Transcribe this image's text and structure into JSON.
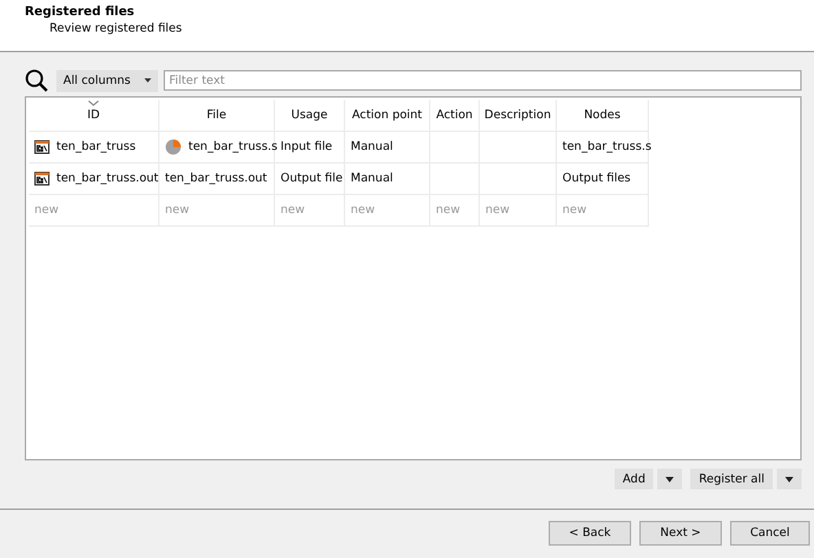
{
  "header": {
    "title": "Registered files",
    "subtitle": "Review registered files"
  },
  "filter": {
    "scope": "All columns",
    "placeholder": "Filter text"
  },
  "table": {
    "columns": [
      {
        "label": "ID",
        "sorted": true
      },
      {
        "label": "File",
        "sorted": false
      },
      {
        "label": "Usage",
        "sorted": false
      },
      {
        "label": "Action point",
        "sorted": false
      },
      {
        "label": "Action",
        "sorted": false
      },
      {
        "label": "Description",
        "sorted": false
      },
      {
        "label": "Nodes",
        "sorted": false
      }
    ],
    "rows": [
      {
        "kind": "file",
        "cells": [
          {
            "text": "ten_bar_truss",
            "kind": "console"
          },
          {
            "text": "ten_bar_truss.s",
            "kind": "disc"
          },
          {
            "text": "Input file"
          },
          {
            "text": "Manual"
          },
          {
            "kind": "empty"
          },
          {
            "kind": "empty"
          },
          {
            "text": "ten_bar_truss.s"
          }
        ]
      },
      {
        "kind": "file",
        "cells": [
          {
            "text": "ten_bar_truss.out",
            "kind": "console"
          },
          {
            "text": "ten_bar_truss.out"
          },
          {
            "text": "Output file"
          },
          {
            "text": "Manual"
          },
          {
            "kind": "empty"
          },
          {
            "kind": "empty"
          },
          {
            "text": "Output files"
          }
        ]
      },
      {
        "kind": "new",
        "cells": [
          {
            "text": "new"
          },
          {
            "text": "new"
          },
          {
            "text": "new"
          },
          {
            "text": "new"
          },
          {
            "text": "new"
          },
          {
            "text": "new"
          },
          {
            "text": "new"
          }
        ]
      }
    ]
  },
  "actions": [
    {
      "label": "Add"
    },
    {
      "label": "Register all"
    }
  ],
  "buttons": [
    "< Back",
    "Next >",
    "Cancel"
  ]
}
